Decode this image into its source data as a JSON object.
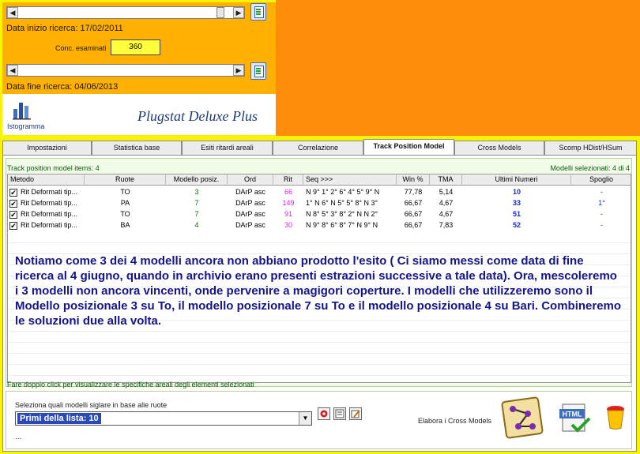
{
  "header": {
    "data_inizio_label": "Data inizio ricerca: 17/02/2011",
    "conc_label": "Conc. esaminati",
    "conc_value": "360",
    "data_fine_label": "Data fine ricerca: 04/06/2013",
    "istogramma_label": "Istogramma",
    "app_title": "Plugstat Deluxe Plus"
  },
  "tabs": [
    {
      "label": "Impostazioni"
    },
    {
      "label": "Statistica base"
    },
    {
      "label": "Esiti ritardi areali"
    },
    {
      "label": "Correlazione"
    },
    {
      "label": "Track Position Model"
    },
    {
      "label": "Cross Models"
    },
    {
      "label": "Scomp HDist/HSum"
    }
  ],
  "panel": {
    "items_label": "Track position model items: 4",
    "selected_label": "Modelli selezionati: 4 di 4",
    "columns": [
      "Metodo",
      "Ruote",
      "Modello posiz.",
      "Ord",
      "Rit",
      "Seq >>>",
      "Win %",
      "TMA",
      "Ultimi Numeri",
      "Spoglio"
    ],
    "rows": [
      {
        "checked": "✔",
        "metodo": "Rit Deformati tip...",
        "ruote": "TO",
        "modello": "3",
        "ord": "DArP asc",
        "rit": "66",
        "seq": "N 9° 1° 2° 6° 4° 5° 9° N",
        "win": "77,78",
        "tma": "5,14",
        "ultimi": "10",
        "spoglio": "-"
      },
      {
        "checked": "✔",
        "metodo": "Rit Deformati tip...",
        "ruote": "PA",
        "modello": "7",
        "ord": "DArP asc",
        "rit": "149",
        "seq": "1° N 6° N 5° 5° 8° N 3°",
        "win": "66,67",
        "tma": "4,67",
        "ultimi": "33",
        "spoglio": "1°"
      },
      {
        "checked": "✔",
        "metodo": "Rit Deformati tip...",
        "ruote": "TO",
        "modello": "7",
        "ord": "DArP asc",
        "rit": "91",
        "seq": "N 8° 5° 3° 8° 2° N N 2°",
        "win": "66,67",
        "tma": "4,67",
        "ultimi": "51",
        "spoglio": "-"
      },
      {
        "checked": "✔",
        "metodo": "Rit Deformati tip...",
        "ruote": "BA",
        "modello": "4",
        "ord": "DArP asc",
        "rit": "30",
        "seq": "N 9° 8° 6° 8° 7° N 9° N",
        "win": "66,67",
        "tma": "7,83",
        "ultimi": "52",
        "spoglio": "-"
      }
    ],
    "note": "Notiamo come 3 dei 4 modelli ancora non abbiano prodotto l'esito ( Ci siamo messi come data di fine ricerca al 4 giugno, quando in archivio erano presenti estrazioni successive a tale data). Ora, mescoleremo i 3 modelli non ancora vincenti, onde pervenire a magigori coperture. I modelli che utilizzeremo sono il Modello posizionale 3 su To, il modello posizionale 7 su To e il modello posizionale 4 su Bari. Combineremo le soluzioni due alla volta.",
    "status": "Fare doppio click per visualizzare le specifiche areali degli elementi selezionati"
  },
  "bottom": {
    "select_label": "Seleziona quali modelli siglare in base alle ruote",
    "combo_value": "Primi della lista: 10",
    "elabora_label": "Elabora i Cross Models",
    "dots": "..."
  },
  "colors": {
    "orange": "#ff8c0a",
    "yellow": "#f8f400",
    "rit_magenta": "#e020e0",
    "ultimi_blue": "#1a2ad0",
    "note_blue": "#14148c"
  }
}
